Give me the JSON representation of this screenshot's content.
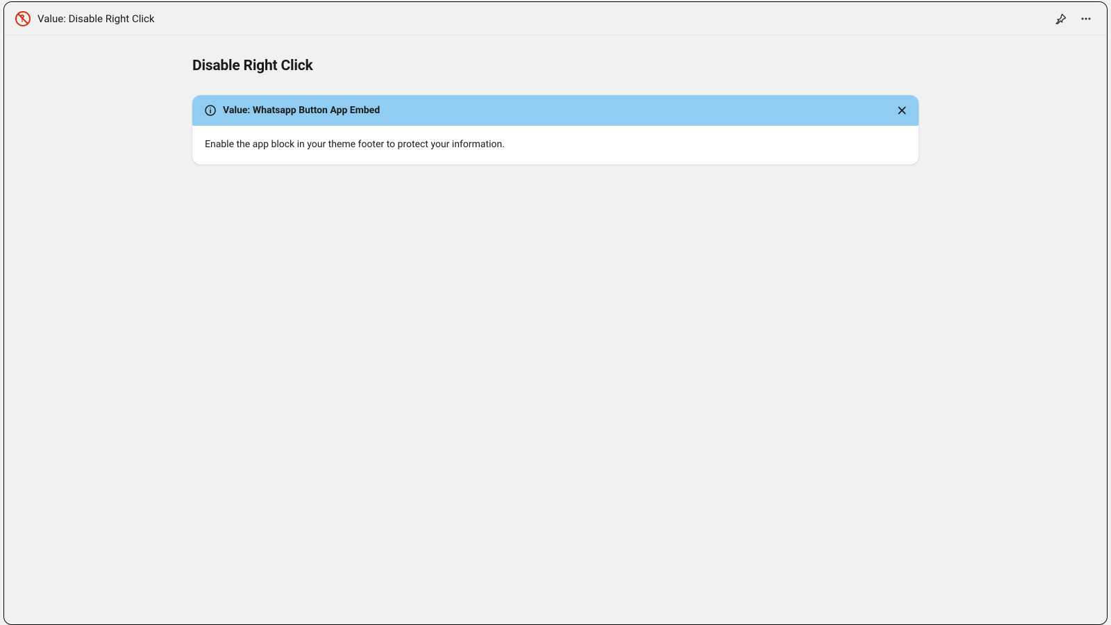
{
  "header": {
    "title": "Value: Disable Right Click"
  },
  "main": {
    "page_title": "Disable Right Click",
    "card": {
      "header_title": "Value: Whatsapp Button App Embed",
      "body_text": "Enable the app block in your theme footer to protect your information."
    }
  }
}
